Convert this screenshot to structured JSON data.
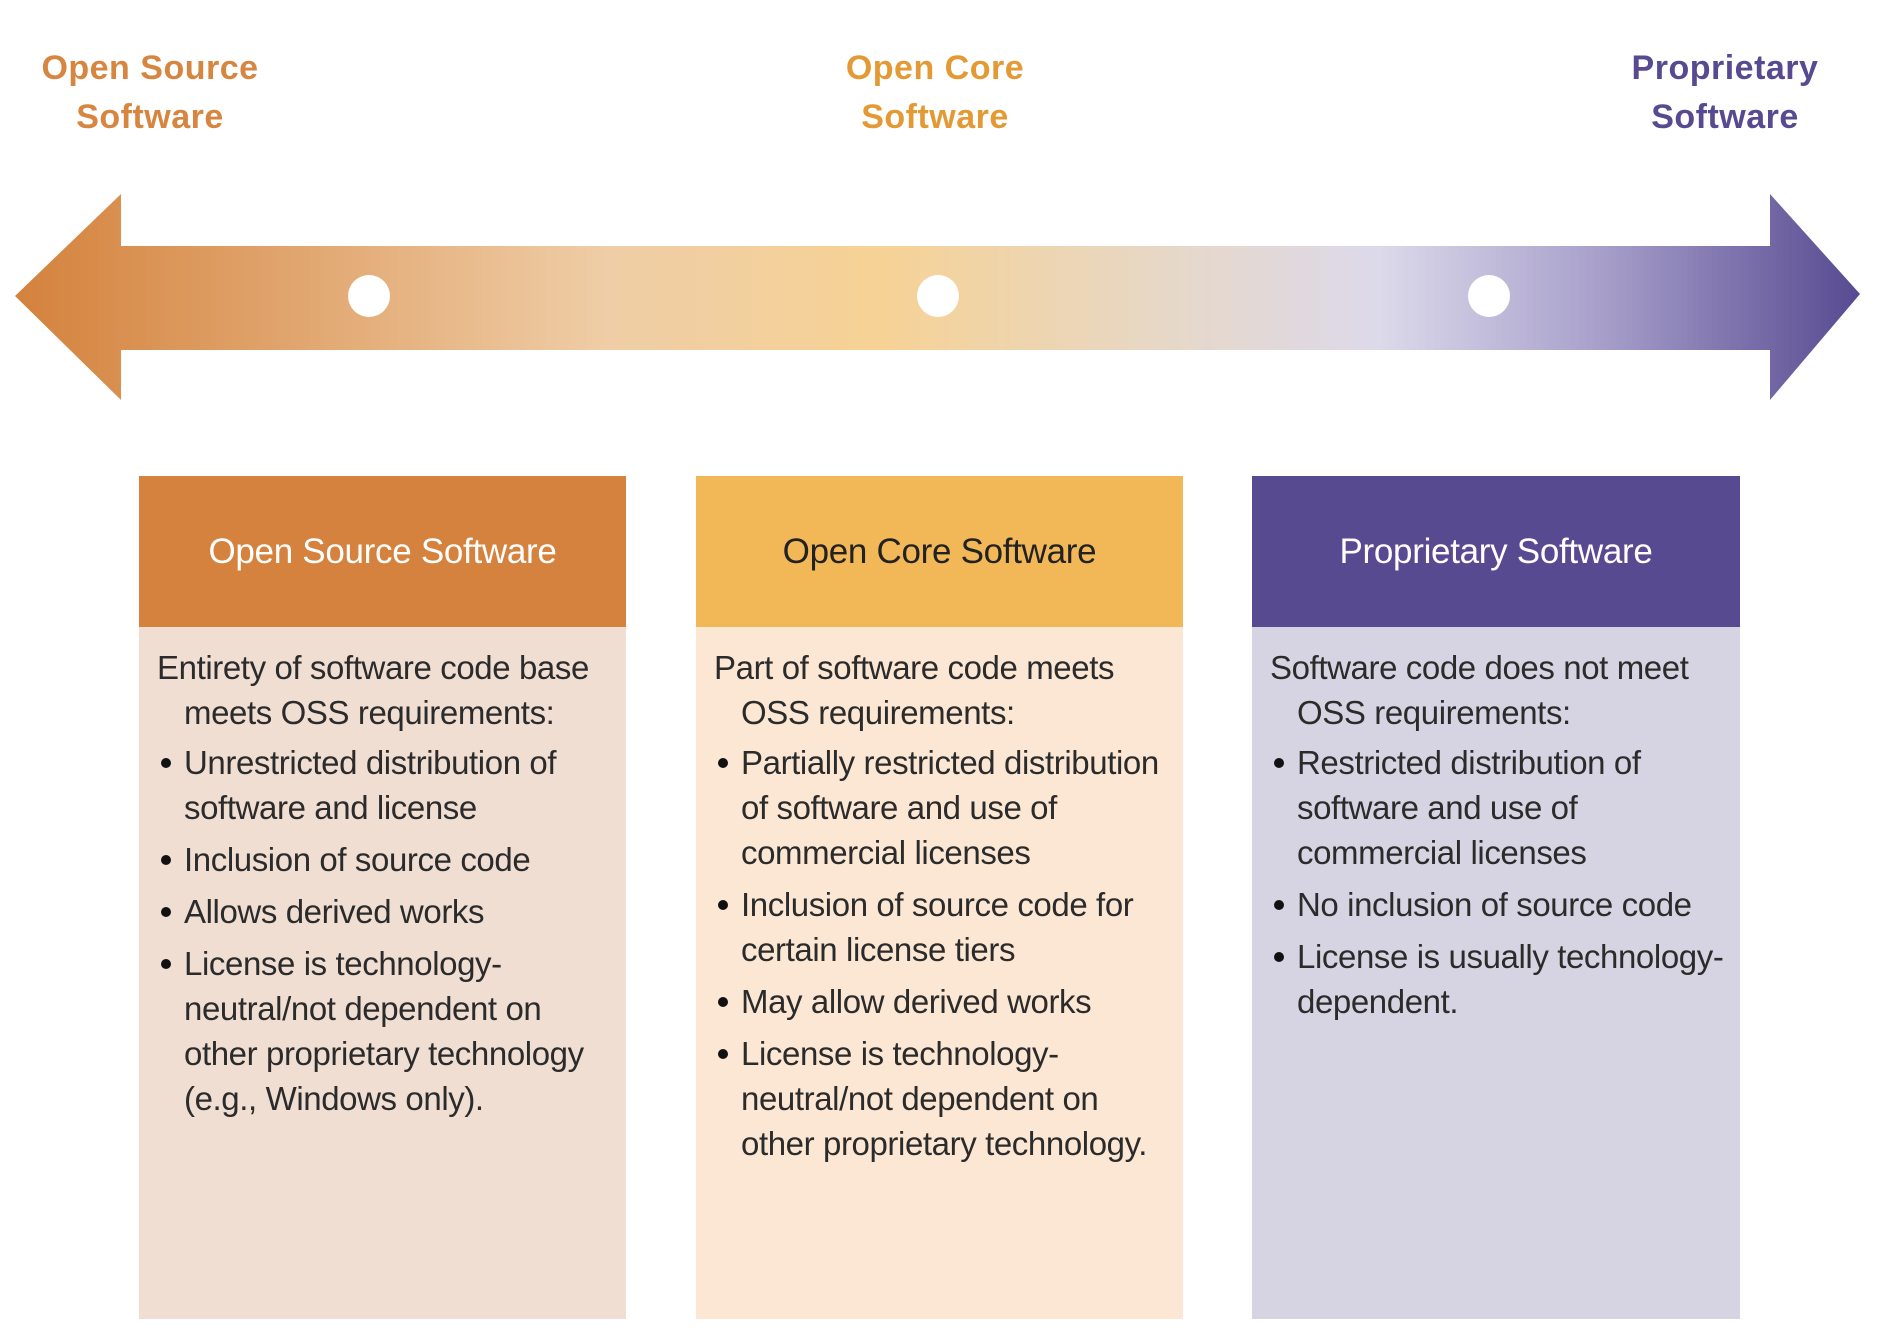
{
  "spectrum": {
    "labels": [
      {
        "line1": "Open Source",
        "line2": "Software",
        "color": "#D68640"
      },
      {
        "line1": "Open Core",
        "line2": "Software",
        "color": "#E39A35"
      },
      {
        "line1": "Proprietary",
        "line2": "Software",
        "color": "#574A91"
      }
    ],
    "arrow_gradient": [
      "#D4823D",
      "#EFCDA6",
      "#F6D295",
      "#E5D8CC",
      "#DCD9EA",
      "#A79FCA",
      "#574A91"
    ],
    "markers": [
      "open-source",
      "open-core",
      "proprietary"
    ]
  },
  "columns": [
    {
      "title": "Open Source Software",
      "header_color": "#D4823D",
      "header_text_color": "#FFFFFF",
      "body_color": "#F0DED3",
      "lead": "Entirety of software code base meets OSS requirements:",
      "bullets": [
        "Unrestricted distribution of software and license",
        "Inclusion of source code",
        "Allows derived  works",
        "License is technology-neutral/not dependent on other proprietary technology (e.g., Windows only)."
      ]
    },
    {
      "title": "Open Core Software",
      "header_color": "#F2B858",
      "header_text_color": "#222222",
      "body_color": "#FBE7D3",
      "lead": "Part of software code meets OSS requirements:",
      "bullets": [
        "Partially restricted distribution of software and use of commercial licenses",
        "Inclusion of source code for certain license tiers",
        "May allow derived works",
        "License is technology-neutral/not dependent on other proprietary technology."
      ]
    },
    {
      "title": "Proprietary Software",
      "header_color": "#574A91",
      "header_text_color": "#FFFFFF",
      "body_color": "#D6D4E2",
      "lead": "Software code  does not meet OSS requirements:",
      "bullets": [
        "Restricted distribution of software and use of commercial licenses",
        "No inclusion of source code",
        "License is usually technology-dependent."
      ]
    }
  ]
}
